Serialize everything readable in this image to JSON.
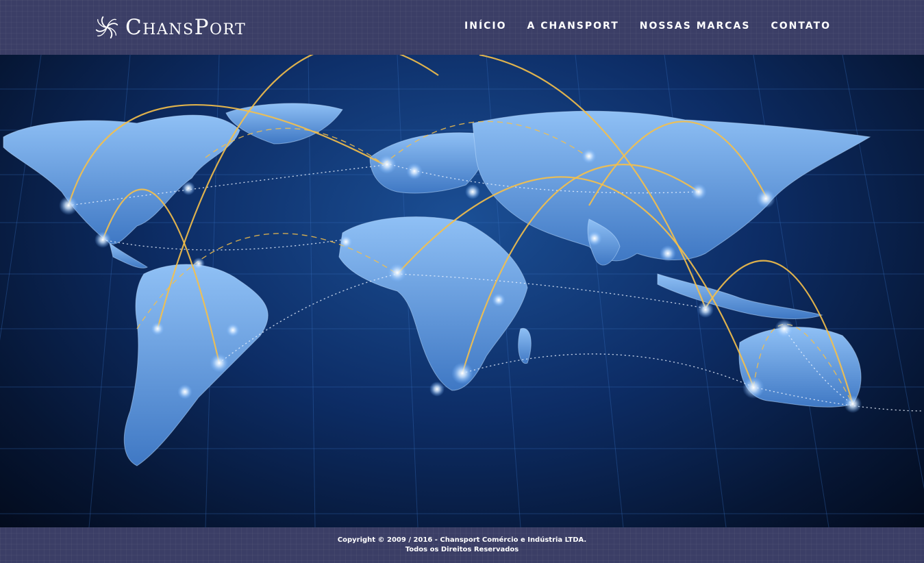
{
  "header": {
    "logo_text": "ChansPort",
    "nav": [
      {
        "label": "INÍCIO"
      },
      {
        "label": "A CHANSPORT"
      },
      {
        "label": "NOSSAS MARCAS"
      },
      {
        "label": "CONTATO"
      }
    ]
  },
  "hero": {
    "image": "world-map-network-icon"
  },
  "footer": {
    "copyright": "Copyright © 2009 / 2016 - Chansport Comércio e Indústria LTDA.",
    "rights": "Todos os Direitos Reservados"
  },
  "colors": {
    "header_bg": "#3b3e66",
    "map_land": "#6fa6e6",
    "map_sea": "#0d2d66",
    "arc_gold": "#f5c04a"
  }
}
